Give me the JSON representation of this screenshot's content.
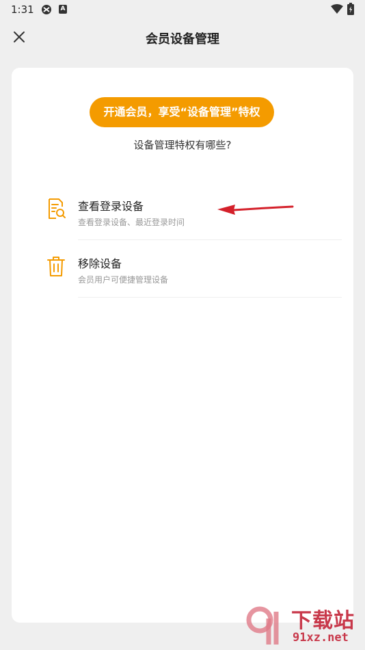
{
  "status_bar": {
    "time": "1:31",
    "icons": [
      "app-icon",
      "a-badge-icon",
      "wifi-icon",
      "battery-icon"
    ],
    "badge_letter": "A"
  },
  "header": {
    "title": "会员设备管理",
    "close_icon": "close-icon"
  },
  "card": {
    "cta_label": "开通会员，享受“设备管理”特权",
    "subheading": "设备管理特权有哪些?",
    "features": [
      {
        "icon": "document-search-icon",
        "title": "查看登录设备",
        "description": "查看登录设备、最近登录时间"
      },
      {
        "icon": "trash-icon",
        "title": "移除设备",
        "description": "会员用户可便捷管理设备"
      }
    ]
  },
  "watermark": {
    "big": "下载站",
    "small": "91xz.net"
  },
  "colors": {
    "accent": "#f49b00",
    "background": "#efefef",
    "card": "#ffffff",
    "annotation_arrow": "#d4202a",
    "watermark": "#c8384a"
  }
}
